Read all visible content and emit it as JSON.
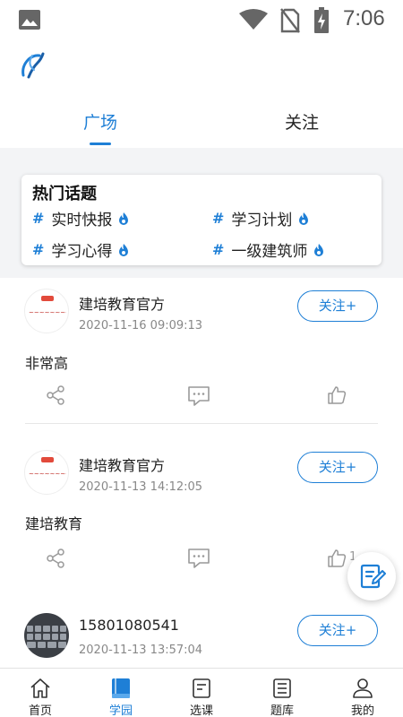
{
  "status_bar": {
    "time": "7:06",
    "icons": [
      "image-icon",
      "wifi-icon",
      "no-sim-icon",
      "battery-charging-icon"
    ]
  },
  "header": {
    "logo": "app-logo"
  },
  "top_tabs": [
    {
      "label": "广场",
      "active": true
    },
    {
      "label": "关注",
      "active": false
    }
  ],
  "hot_topics": {
    "title": "热门话题",
    "items": [
      {
        "hash": "#",
        "label": "实时快报"
      },
      {
        "hash": "#",
        "label": "学习计划"
      },
      {
        "hash": "#",
        "label": "学习心得"
      },
      {
        "hash": "#",
        "label": "一级建筑师"
      }
    ]
  },
  "posts": [
    {
      "author": "建培教育官方",
      "time": "2020-11-16 09:09:13",
      "follow_label": "关注+",
      "text": "非常高",
      "like_count": ""
    },
    {
      "author": "建培教育官方",
      "time": "2020-11-13 14:12:05",
      "follow_label": "关注+",
      "text": "建培教育",
      "like_count": "1"
    },
    {
      "author": "15801080541",
      "time": "2020-11-13 13:57:04",
      "follow_label": "关注+",
      "text": "",
      "like_count": ""
    }
  ],
  "fab": {
    "icon": "edit-note-icon"
  },
  "bottom_nav": [
    {
      "label": "首页",
      "icon": "home-icon",
      "active": false
    },
    {
      "label": "学园",
      "icon": "book-icon",
      "active": true
    },
    {
      "label": "选课",
      "icon": "course-icon",
      "active": false
    },
    {
      "label": "题库",
      "icon": "question-bank-icon",
      "active": false
    },
    {
      "label": "我的",
      "icon": "profile-icon",
      "active": false
    }
  ],
  "colors": {
    "accent": "#1e7fd6",
    "background": "#f3f4f6",
    "text": "#222222",
    "muted": "#888888"
  }
}
